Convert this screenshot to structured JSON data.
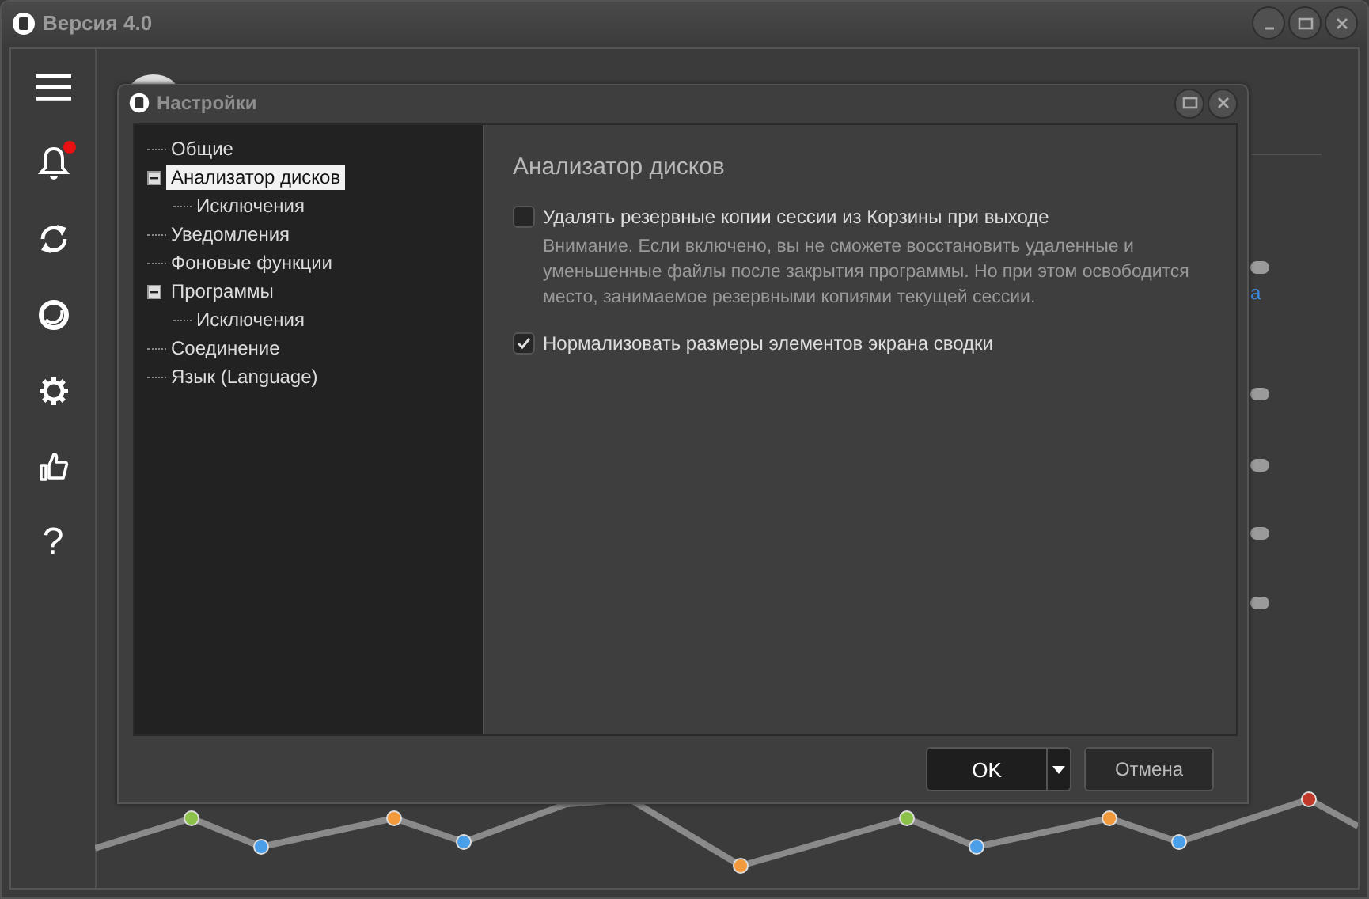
{
  "window": {
    "title": "Версия 4.0"
  },
  "sidebar": {
    "items": [
      {
        "kind": "menu"
      },
      {
        "kind": "bell",
        "badge": true
      },
      {
        "kind": "refresh"
      },
      {
        "kind": "disk"
      },
      {
        "kind": "gear"
      },
      {
        "kind": "thumb"
      },
      {
        "kind": "help",
        "label": "?"
      }
    ]
  },
  "background": {
    "link_fragment": "а",
    "toggles": [
      {
        "on": false
      },
      {
        "on": false
      },
      {
        "on": false
      },
      {
        "on": false
      },
      {
        "on": false
      }
    ]
  },
  "dialog": {
    "title": "Настройки",
    "tree": [
      {
        "label": "Общие",
        "selected": false
      },
      {
        "label": "Анализатор дисков",
        "selected": true,
        "expanded": true,
        "children": [
          {
            "label": "Исключения",
            "selected": false
          }
        ]
      },
      {
        "label": "Уведомления",
        "selected": false
      },
      {
        "label": "Фоновые функции",
        "selected": false
      },
      {
        "label": "Программы",
        "selected": false,
        "expanded": true,
        "children": [
          {
            "label": "Исключения",
            "selected": false
          }
        ]
      },
      {
        "label": "Соединение",
        "selected": false
      },
      {
        "label": "Язык (Language)",
        "selected": false
      }
    ],
    "section_title": "Анализатор дисков",
    "options": [
      {
        "label": "Удалять резервные копии сессии из Корзины при выходе",
        "checked": false,
        "note": "Внимание. Если включено, вы не сможете восстановить удаленные и уменьшенные файлы после закрытия программы. Но при этом освободится место, занимаемое резервными копиями текущей сессии."
      },
      {
        "label": "Нормализовать размеры элементов экрана сводки",
        "checked": true
      }
    ],
    "buttons": {
      "ok": "OK",
      "cancel": "Отмена"
    }
  }
}
